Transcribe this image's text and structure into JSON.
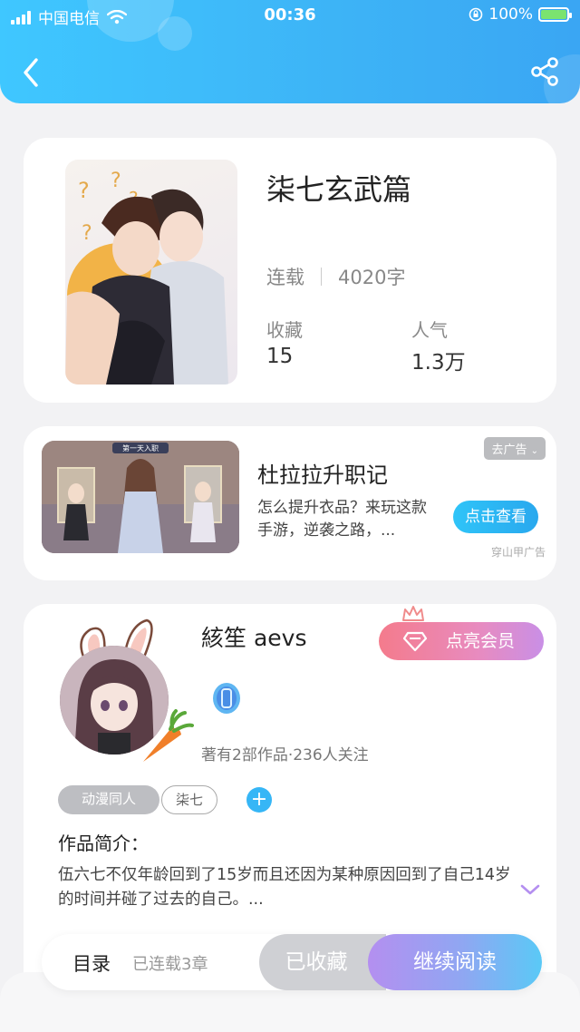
{
  "status_bar": {
    "carrier": "中国电信",
    "time": "00:36",
    "battery": "100%"
  },
  "book": {
    "title": "柒七玄武篇",
    "status": "连载",
    "word_count": "4020字",
    "favorites_label": "收藏",
    "favorites_value": "15",
    "popularity_label": "人气",
    "popularity_value": "1.3万"
  },
  "ad": {
    "tag": "去广告",
    "title": "杜拉拉升职记",
    "description": "怎么提升衣品？来玩这款手游，逆袭之路，...",
    "button": "点击查看",
    "source": "穿山甲广告",
    "banner_text": "第一天入职"
  },
  "author": {
    "name": "絯笙 aevs",
    "vip_button": "点亮会员",
    "stats": "著有2部作品·236人关注",
    "tags": [
      "动漫同人",
      "柒七"
    ],
    "tag_add": "+",
    "intro_label": "作品简介：",
    "intro_text": "伍六七不仅年龄回到了15岁而且还因为某种原因回到了自己14岁的时间并碰了过去的自己。..."
  },
  "bottom_bar": {
    "toc": "目录",
    "serial_info": "已连载3章",
    "collected": "已收藏",
    "continue_reading": "继续阅读"
  },
  "colors": {
    "header_blue": "#3db3f6",
    "accent_blue": "#36b6f6",
    "vip_pink": "#f47b8c",
    "read_purple": "#b48ff0"
  },
  "icons": {
    "back": "chevron-left-icon",
    "share": "share-icon",
    "vip": "diamond-icon",
    "crown": "crown-icon",
    "expand": "chevron-down-icon",
    "medal": "medal-icon"
  }
}
